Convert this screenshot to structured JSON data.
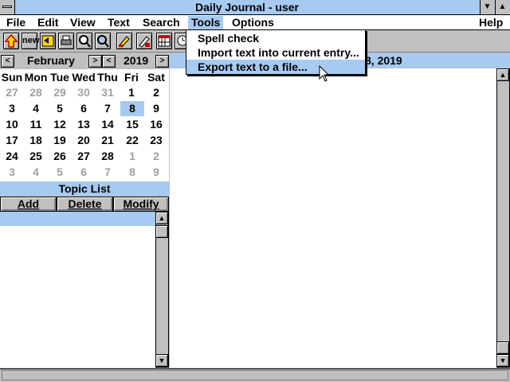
{
  "window": {
    "title": "Daily Journal - user"
  },
  "menu": {
    "file": "File",
    "edit": "Edit",
    "view": "View",
    "text": "Text",
    "search": "Search",
    "tools": "Tools",
    "options": "Options",
    "help": "Help"
  },
  "toolbar": {
    "new_label": "new"
  },
  "tools_menu": {
    "items": [
      "Spell check",
      "Import text into current entry...",
      "Export text to a file..."
    ]
  },
  "calendar": {
    "month": "February",
    "year": "2019",
    "prev": "<",
    "next": ">",
    "weekdays": [
      "Sun",
      "Mon",
      "Tue",
      "Wed",
      "Thu",
      "Fri",
      "Sat"
    ],
    "weeks": [
      [
        "27",
        "28",
        "29",
        "30",
        "31",
        "1",
        "2"
      ],
      [
        "3",
        "4",
        "5",
        "6",
        "7",
        "8",
        "9"
      ],
      [
        "10",
        "11",
        "12",
        "13",
        "14",
        "15",
        "16"
      ],
      [
        "17",
        "18",
        "19",
        "20",
        "21",
        "22",
        "23"
      ],
      [
        "24",
        "25",
        "26",
        "27",
        "28",
        "1",
        "2"
      ],
      [
        "3",
        "4",
        "5",
        "6",
        "7",
        "8",
        "9"
      ]
    ]
  },
  "topic_list": {
    "header": "Topic List",
    "add": "Add",
    "delete": "Delete",
    "modify": "Modify"
  },
  "editor": {
    "date_fragment": "8, 2019"
  },
  "scroll": {
    "up": "▲",
    "down": "▼"
  }
}
